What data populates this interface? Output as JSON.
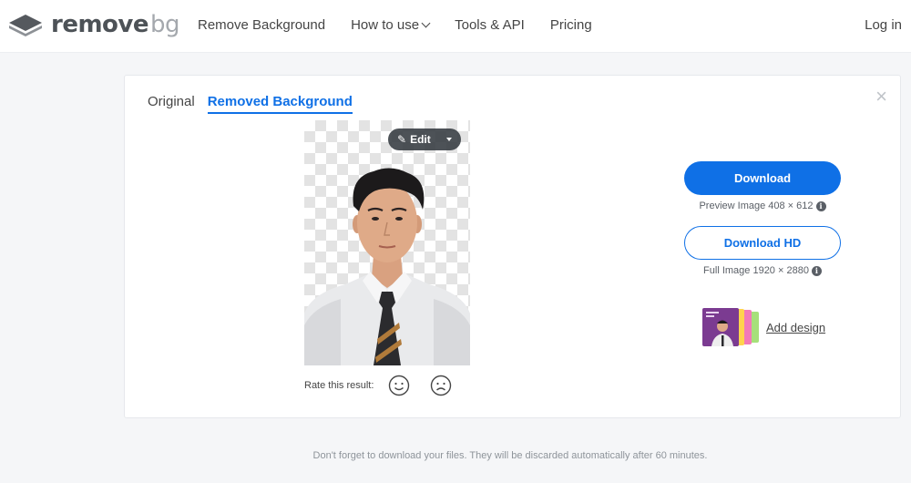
{
  "brand": {
    "name_main": "remove",
    "name_soft": "bg"
  },
  "nav": {
    "items": [
      {
        "label": "Remove Background"
      },
      {
        "label": "How to use"
      },
      {
        "label": "Tools & API"
      },
      {
        "label": "Pricing"
      }
    ],
    "login_label": "Log in"
  },
  "card": {
    "tabs": [
      {
        "label": "Original",
        "active": false
      },
      {
        "label": "Removed Background",
        "active": true
      }
    ],
    "close_symbol": "×",
    "edit_label": "Edit",
    "rate_label": "Rate this result:",
    "download_label": "Download",
    "preview_text": "Preview Image 408 × 612",
    "download_hd_label": "Download HD",
    "full_text": "Full Image 1920 × 2880",
    "add_design_label": "Add design"
  },
  "footer": {
    "note": "Don't forget to download your files. They will be discarded automatically after 60 minutes."
  },
  "colors": {
    "accent": "#0f70e6",
    "text": "#454545",
    "background": "#f5f6f8"
  },
  "icons": [
    "logo-icon",
    "chevron-down-icon",
    "close-icon",
    "brush-icon",
    "caret-down-icon",
    "smile-icon",
    "frown-icon",
    "info-icon"
  ]
}
